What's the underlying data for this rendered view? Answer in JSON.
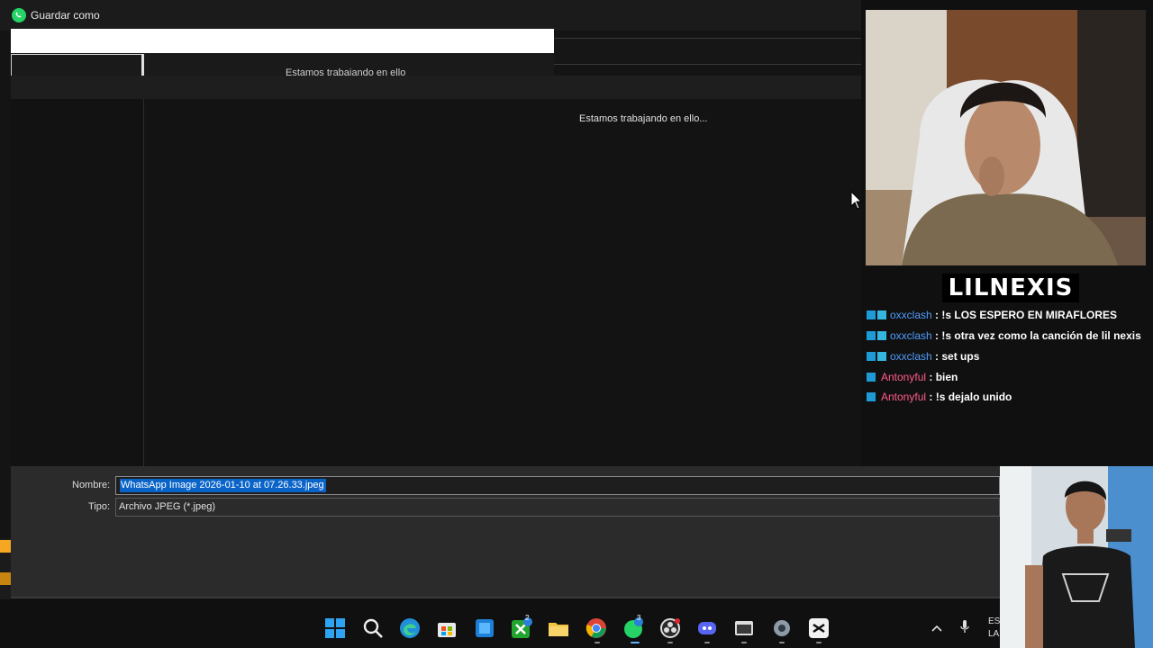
{
  "window": {
    "title": "Guardar como"
  },
  "dialog": {
    "command_bar_ghost_text": "Estamos trabajando en ello",
    "loading_text": "Estamos trabajando en ello...",
    "name_label": "Nombre:",
    "name_value": "WhatsApp Image 2026-01-10 at 07.26.33.jpeg",
    "type_label": "Tipo:",
    "type_value": "Archivo JPEG (*.jpeg)"
  },
  "stream": {
    "streamer_name": "LILNEXIS",
    "chat": [
      {
        "user": "oxxclash",
        "user_color": "#4f9cff",
        "message": ": !s LOS ESPERO EN MIRAFLORES",
        "badges": 2
      },
      {
        "user": "oxxclash",
        "user_color": "#4f9cff",
        "message": ": !s otra vez como la canción de lil nexis",
        "badges": 2
      },
      {
        "user": "oxxclash",
        "user_color": "#4f9cff",
        "message": ": set ups",
        "badges": 2
      },
      {
        "user": "Antonyful",
        "user_color": "#ff5c8a",
        "message": ": bien",
        "badges": 1
      },
      {
        "user": "Antonyful",
        "user_color": "#ff5c8a",
        "message": ": !s dejalo unido",
        "badges": 1
      }
    ]
  },
  "taskbar": {
    "icons": [
      "windows-start-icon",
      "search-icon",
      "edge-icon",
      "store-icon",
      "blue-app-icon",
      "xbox-icon",
      "file-explorer-icon",
      "chrome-icon",
      "whatsapp-icon",
      "obs-icon",
      "discord-icon",
      "capture-app-icon",
      "settings-icon",
      "capcut-icon"
    ],
    "xbox_badge": "2",
    "whatsapp_badge": "3",
    "tray_text_line1": "ES",
    "tray_text_line2": "LA"
  },
  "colors": {
    "selection": "#0a64c8",
    "whatsapp_green": "#25d366",
    "chat_blue_user": "#4f9cff",
    "chat_pink_user": "#ff5c8a"
  }
}
